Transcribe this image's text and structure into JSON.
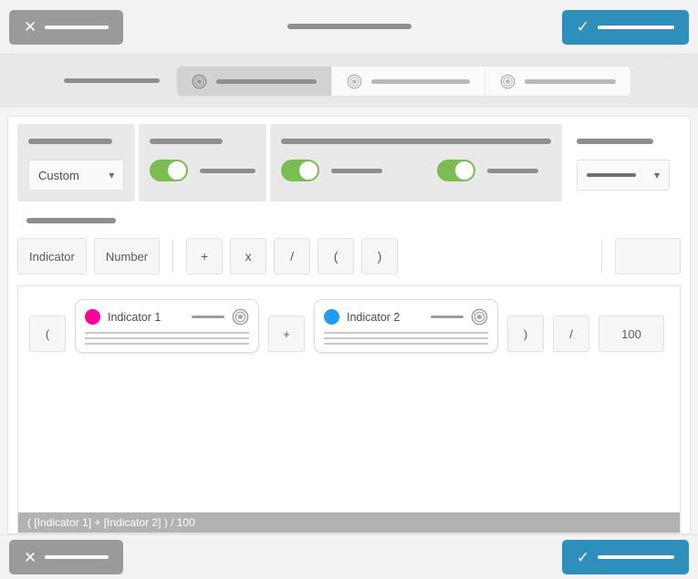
{
  "window": {
    "title_redacted": true
  },
  "topbar": {
    "cancel": {
      "icon": "close-icon",
      "glyph": "×",
      "label_redacted": true
    },
    "confirm": {
      "icon": "check-icon",
      "glyph": "✓",
      "label_redacted": true
    },
    "title_redacted": true
  },
  "steps": {
    "lead_label_redacted": true,
    "options": [
      {
        "id": "step-1",
        "label_redacted": true,
        "selected": true
      },
      {
        "id": "step-2",
        "label_redacted": true,
        "selected": false
      },
      {
        "id": "step-3",
        "label_redacted": true,
        "selected": false
      }
    ]
  },
  "settings": {
    "type_group": {
      "label_redacted": true,
      "select_value": "Custom",
      "chevron": "⌄"
    },
    "toggle_group_1": {
      "label_redacted": true,
      "toggles": [
        {
          "on": true,
          "label_redacted": true
        }
      ]
    },
    "toggle_group_2": {
      "label_redacted": true,
      "toggles": [
        {
          "on": true,
          "label_redacted": true
        },
        {
          "on": true,
          "label_redacted": true
        }
      ]
    },
    "last_group": {
      "label_redacted": true,
      "select_value_redacted": true,
      "chevron": "⌄"
    }
  },
  "operators": {
    "section_label_redacted": true,
    "sources": [
      {
        "id": "indicator",
        "label": "Indicator"
      },
      {
        "id": "number",
        "label": "Number"
      }
    ],
    "ops": [
      {
        "id": "plus",
        "label": "+"
      },
      {
        "id": "times",
        "label": "x"
      },
      {
        "id": "divide",
        "label": "/"
      },
      {
        "id": "paren-open",
        "label": "("
      },
      {
        "id": "paren-close",
        "label": ")"
      }
    ],
    "value_input": {
      "value": "",
      "placeholder": ""
    }
  },
  "canvas": {
    "tokens": [
      {
        "kind": "op",
        "label": "("
      },
      {
        "kind": "indicator",
        "name": "Indicator 1",
        "color": "#ff0098",
        "line_icon": "line-icon",
        "target_icon": "target-icon",
        "detail_lines_redacted": 3
      },
      {
        "kind": "op",
        "label": "+"
      },
      {
        "kind": "indicator",
        "name": "Indicator 2",
        "color": "#1f9cf0",
        "line_icon": "line-icon",
        "target_icon": "target-icon",
        "detail_lines_redacted": 3
      },
      {
        "kind": "op",
        "label": ")"
      },
      {
        "kind": "op",
        "label": "/"
      },
      {
        "kind": "number",
        "label": "100"
      }
    ],
    "formula_preview": "( [Indicator 1] + [Indicator 2] ) / 100"
  },
  "bottombar": {
    "cancel": {
      "icon": "close-icon",
      "glyph": "×",
      "label_redacted": true
    },
    "confirm": {
      "icon": "check-icon",
      "glyph": "✓",
      "label_redacted": true
    }
  },
  "colors": {
    "accent_blue": "#2e8ebc",
    "toggle_green": "#7bbd51",
    "indicator_1": "#ff0098",
    "indicator_2": "#1f9cf0",
    "cancel_gray": "#9a9a9a",
    "preview_bar": "#b2b2b2"
  }
}
